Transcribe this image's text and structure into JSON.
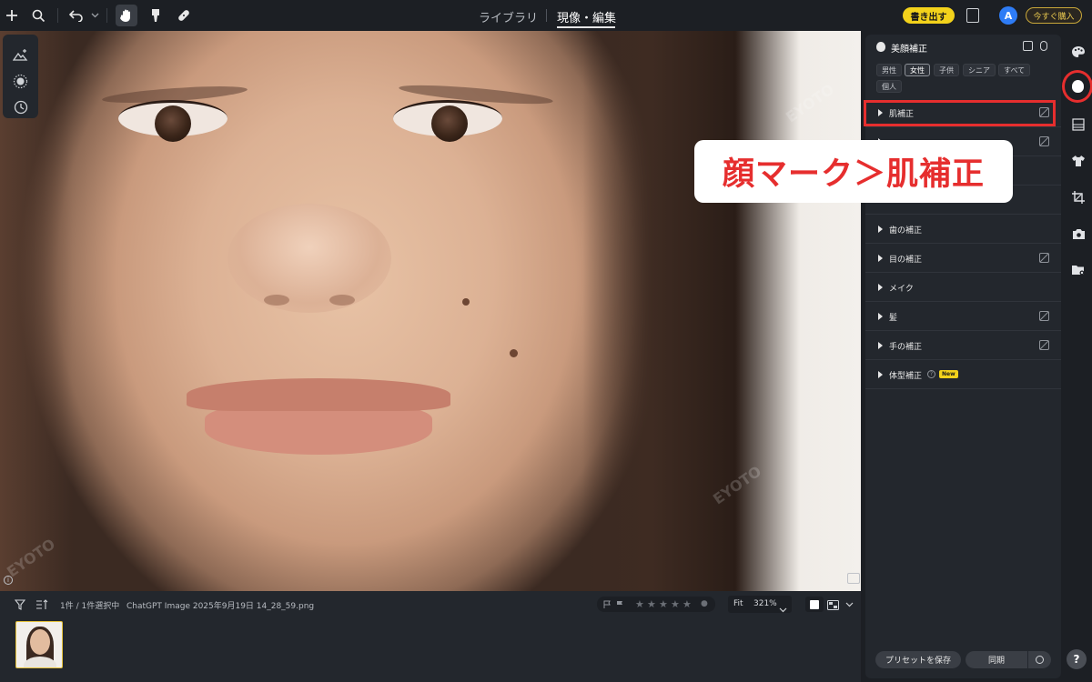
{
  "topbar": {
    "tab_library": "ライブラリ",
    "tab_develop": "現像・編集",
    "export_label": "書き出す",
    "avatar_letter": "A",
    "buy_label": "今すぐ購入"
  },
  "photo": {
    "watermark": "EYOTO"
  },
  "filmstrip": {
    "selection_text": "1件 / 1件選択中",
    "filename": "ChatGPT Image 2025年9月19日 14_28_59.png",
    "fit_label": "Fit",
    "zoom_label": "321%",
    "star_count": 5
  },
  "panel": {
    "title": "美顔補正",
    "chips": [
      "男性",
      "女性",
      "子供",
      "シニア",
      "すべて",
      "個人"
    ],
    "active_chip": "女性",
    "sections": [
      {
        "label": "肌補正",
        "has_reset": true
      },
      {
        "label": "歯の補正",
        "has_reset": false
      },
      {
        "label": "目の補正",
        "has_reset": true
      },
      {
        "label": "メイク",
        "has_reset": false
      },
      {
        "label": "髪",
        "has_reset": true
      },
      {
        "label": "手の補正",
        "has_reset": true
      },
      {
        "label": "体型補正",
        "has_reset": false,
        "badge": "New"
      }
    ],
    "preset_label": "プリセットを保存",
    "sync_label": "同期"
  },
  "annotation": {
    "callout_text": "顔マーク＞肌補正",
    "highlight_color": "#e62e2e"
  },
  "colors": {
    "accent_yellow": "#f3d21b",
    "avatar_blue": "#2e7cf6"
  }
}
